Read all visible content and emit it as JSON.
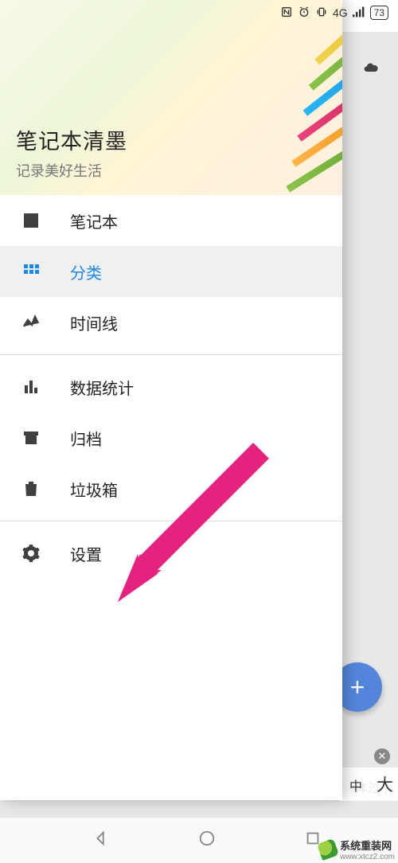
{
  "statusbar": {
    "network": "4G",
    "battery": "73"
  },
  "header": {
    "title": "笔记本清墨",
    "subtitle": "记录美好生活"
  },
  "menu": {
    "notebook": "笔记本",
    "category": "分类",
    "timeline": "时间线",
    "stats": "数据统计",
    "archive": "归档",
    "trash": "垃圾箱",
    "settings": "设置"
  },
  "accent_color": "#1a87ee",
  "arrow_color": "#e6227f",
  "floating": {
    "hint": "体过小",
    "size_mid": "中",
    "size_large": "大"
  },
  "watermark": {
    "brand": "系统重装网",
    "url": "www.xtcz2.com"
  }
}
